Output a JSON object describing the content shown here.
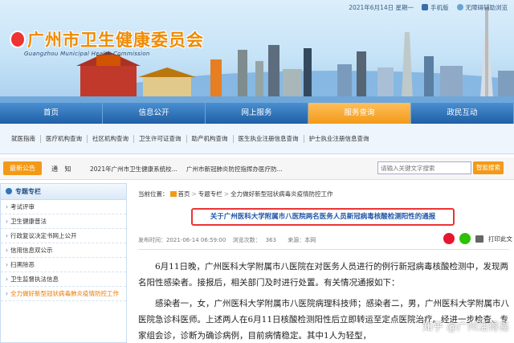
{
  "topbar": {
    "date": "2021年6月14日 星期一",
    "mobile": "手机版",
    "accessibility": "无障碍辅助浏览"
  },
  "header": {
    "title": "广州市卫生健康委员会",
    "subtitle": "Guangzhou Municipal Health Commission"
  },
  "mainnav": [
    "首页",
    "信息公开",
    "网上服务",
    "服务查询",
    "政民互动"
  ],
  "mainnav_active": "服务查询",
  "subnav": [
    "就医指南",
    "医疗机构查询",
    "社区机构查询",
    "卫生许可证查询",
    "助产机构查询",
    "医生执业注册信息查询",
    "护士执业注册信息查询"
  ],
  "notice": {
    "tag": "最新公告",
    "label": "通 知",
    "items": [
      "2021年广州市卫生健康系统校...",
      "广州市新冠肺炎防控指挥办医疗防..."
    ],
    "search_placeholder": "请输入关键文字搜索",
    "search_button": "智能搜索"
  },
  "sidebar": {
    "title": "专题专栏",
    "items": [
      "考试评审",
      "卫生健康普法",
      "行政复议决定书网上公开",
      "信用信息双公示",
      "扫黑除恶",
      "卫生监督执法信息",
      "全力做好新型冠状病毒肺炎疫情防控工作"
    ]
  },
  "breadcrumb": {
    "prefix": "当前位置：",
    "items": [
      "首页",
      "专题专栏",
      "全力做好新型冠状病毒炎疫情防控工作"
    ]
  },
  "article": {
    "title": "关于广州医科大学附属市八医院两名医务人员新冠病毒核酸检测阳性的通报",
    "publish_time": "发布时间：2021-06-14 06:59:00",
    "views_label": "浏览次数：",
    "views": "363",
    "source": "来源：本网",
    "print": "打印此文",
    "paragraphs": [
      "6月11日晚，广州医科大学附属市八医院在对医务人员进行的例行新冠病毒核酸检测中，发现两名阳性感染者。接报后，相关部门及时进行处置。有关情况通报如下：",
      "感染者一，女，广州医科大学附属市八医院病理科技师；感染者二，男，广州医科大学附属市八医院急诊科医师。上述两人在6月11日核酸检测阳性后立即转运至定点医院治疗。经进一步检查、专家组会诊，诊断为确诊病例，目前病情稳定。其中1人为轻型，"
    ]
  },
  "watermark": "知乎 @广州活得易",
  "colors": {
    "nav_blue": "#1f5fa6",
    "accent_orange": "#f29a18",
    "title_orange": "#f08a00",
    "highlight_red": "#e33",
    "link_blue": "#1f55a6"
  }
}
